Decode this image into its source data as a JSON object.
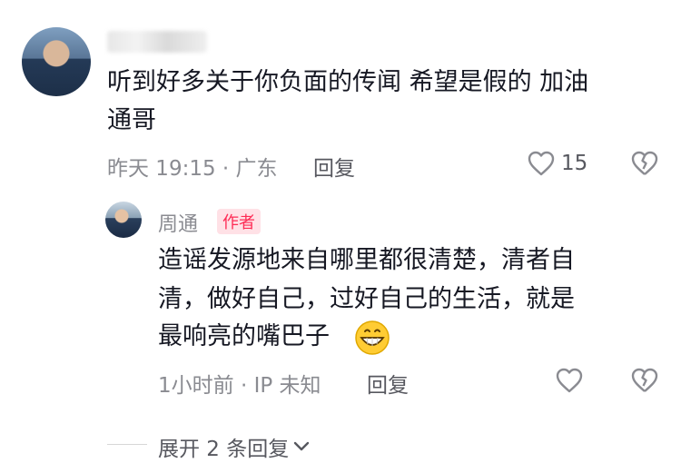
{
  "comment": {
    "username": "",
    "text_line1": "听到好多关于你负面的传闻 希望是假的 加油",
    "text_line2": "通哥",
    "time_location": "昨天 19:15 · 广东",
    "reply_label": "回复",
    "like_count": "15"
  },
  "reply": {
    "author_name": "周通",
    "author_badge": "作者",
    "text_line1": "造谣发源地来自哪里都很清楚，清者自",
    "text_line2": "清，做好自己，过好自己的生活，就是",
    "text_line3": "最响亮的嘴巴子",
    "emoji": "grinning-face-icon",
    "time_location": "1小时前 · IP 未知",
    "reply_label": "回复"
  },
  "expand_label": "展开 2 条回复",
  "colors": {
    "badge": "#fe2c55",
    "meta": "#8a8b91"
  }
}
